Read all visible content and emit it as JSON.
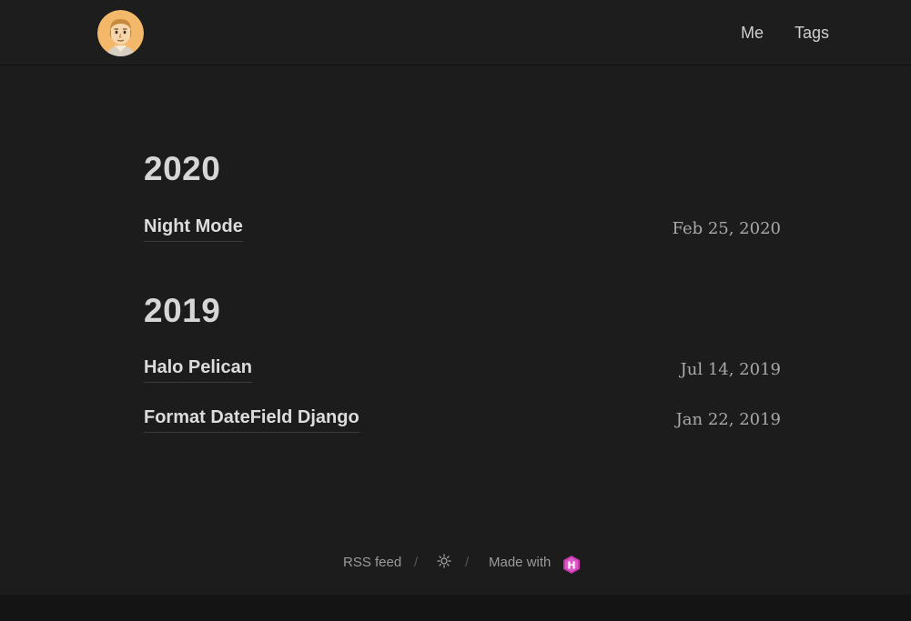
{
  "header": {
    "nav": [
      {
        "label": "Me"
      },
      {
        "label": "Tags"
      }
    ]
  },
  "archive": [
    {
      "year": "2020",
      "posts": [
        {
          "title": "Night Mode",
          "date": "Feb 25, 2020"
        }
      ]
    },
    {
      "year": "2019",
      "posts": [
        {
          "title": "Halo Pelican",
          "date": "Jul 14, 2019"
        },
        {
          "title": "Format DateField Django",
          "date": "Jan 22, 2019"
        }
      ]
    }
  ],
  "footer": {
    "rss_label": "RSS feed",
    "separator": "/",
    "theme_toggle_icon": "sun-icon",
    "made_with_label": "Made with",
    "made_with_icon": "hugo-icon",
    "made_with_letter": "H"
  },
  "colors": {
    "background": "#1c1c1c",
    "header_background": "#1d1d1d",
    "text": "#dcdcdc",
    "date_text": "#a9a9a9",
    "hugo_badge": "#c039a8"
  }
}
